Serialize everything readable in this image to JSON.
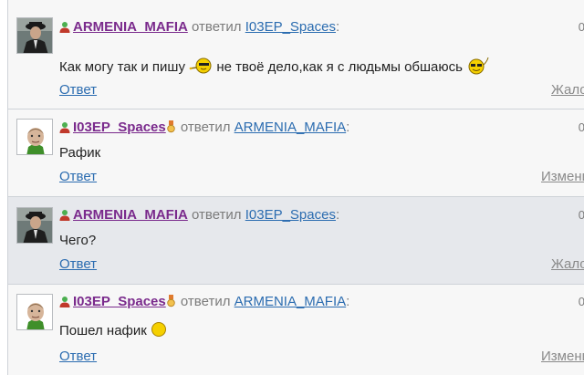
{
  "common": {
    "replied_word": "ответил",
    "colon": ":",
    "reply_label": "Ответ"
  },
  "posts": [
    {
      "author": "ARMENIA_MAFIA",
      "target": "I03EP_Spaces",
      "time": "0",
      "text_before": "Как могу так и пишу",
      "text_after": "не твоё дело,как я с людьмы обшаюсь",
      "right_link": "Жалоб"
    },
    {
      "author": "I03EP_Spaces",
      "target": "ARMENIA_MAFIA",
      "time": "0",
      "text": "Рафик",
      "right_link": "Измени"
    },
    {
      "author": "ARMENIA_MAFIA",
      "target": "I03EP_Spaces",
      "time": "0",
      "text": "Чего?",
      "right_link": "Жалоб"
    },
    {
      "author": "I03EP_Spaces",
      "target": "ARMENIA_MAFIA",
      "time": "0",
      "text": "Пошел нафик",
      "right_link": "Измени"
    }
  ],
  "icons": {
    "user": "user-icon",
    "badge": "medal-badge-icon",
    "smiley_sunglasses": "sunglasses-smiley-icon",
    "smiley_cool": "cool-smiley-icon",
    "smiley_plain": "yellow-smiley-icon"
  },
  "colors": {
    "author": "#7a2a8c",
    "link": "#2b6cb0",
    "muted": "#7b7b7b",
    "highlight_bg": "#e6e8ec",
    "border": "#cfd3d8"
  }
}
